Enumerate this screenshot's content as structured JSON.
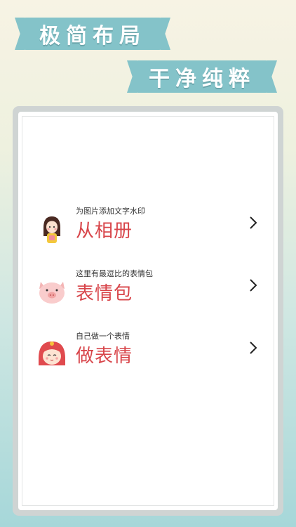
{
  "banners": {
    "line1": "极简布局",
    "line2": "干净纯粹"
  },
  "menu": {
    "items": [
      {
        "subtitle": "为图片添加文字水印",
        "title": "从相册",
        "icon": "girl-avatar-icon"
      },
      {
        "subtitle": "这里有最逗比的表情包",
        "title": "表情包",
        "icon": "pig-face-icon"
      },
      {
        "subtitle": "自己做一个表情",
        "title": "做表情",
        "icon": "red-hood-girl-icon"
      }
    ],
    "chevron_icon": "chevron-right-icon"
  },
  "colors": {
    "banner": "#84c3c9",
    "title": "#d8454a",
    "subtitle": "#333333",
    "frame": "#cfd4d3",
    "background_top": "#f7f3e4",
    "background_bottom": "#a6d7d9"
  }
}
